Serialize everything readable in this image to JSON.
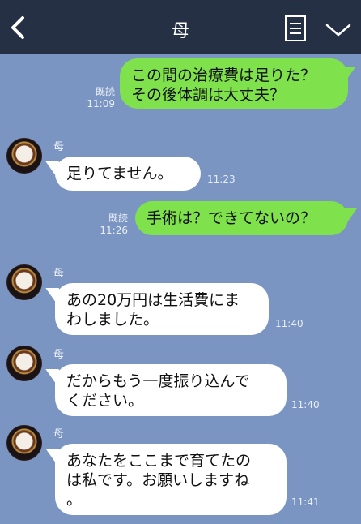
{
  "header": {
    "title": "母"
  },
  "contact_name": "母",
  "messages": [
    {
      "direction": "out",
      "lines": [
        "この間の治療費は足りた？",
        "その後体調は大丈夫？"
      ],
      "read": "既読",
      "time": "11:09"
    },
    {
      "direction": "in",
      "lines": [
        "足りてません。"
      ],
      "time": "11:23"
    },
    {
      "direction": "out",
      "lines": [
        "手術は？できてないの？"
      ],
      "read": "既読",
      "time": "11:26"
    },
    {
      "direction": "in",
      "lines": [
        "あの20万円は生活費にま",
        "わしました。"
      ],
      "time": "11:40"
    },
    {
      "direction": "in",
      "lines": [
        "だからもう一度振り込んで",
        "ください。"
      ],
      "time": "11:40"
    },
    {
      "direction": "in",
      "lines": [
        "あなたをここまで育てたの",
        "は私です。お願いしますね",
        "。"
      ],
      "time": "11:41"
    }
  ]
}
